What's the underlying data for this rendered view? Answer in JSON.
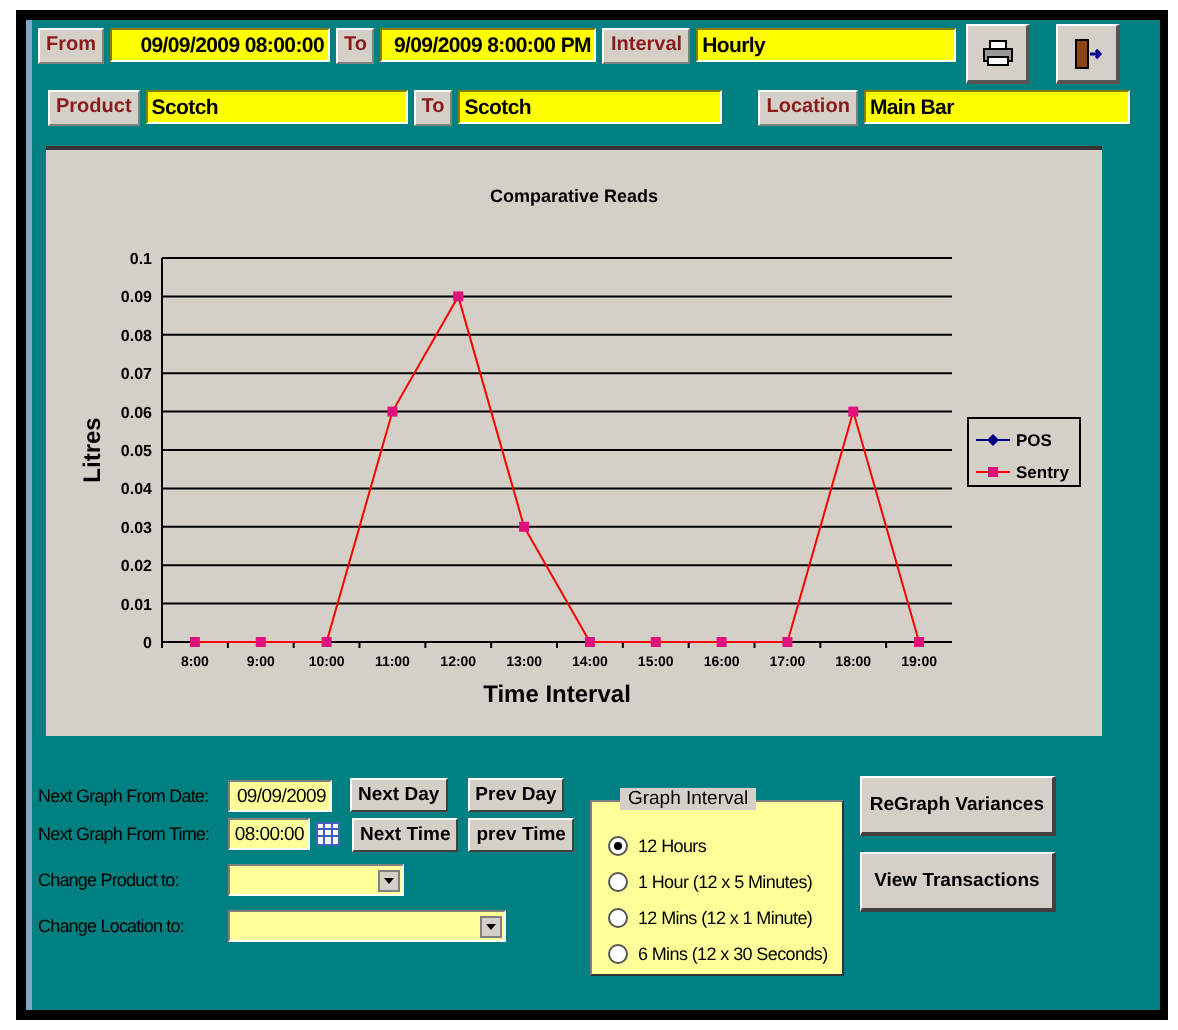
{
  "filter_row_1": {
    "from_label": "From",
    "from_value": "09/09/2009 08:00:00",
    "to_label": "To",
    "to_value": "9/09/2009 8:00:00 PM",
    "interval_label": "Interval",
    "interval_value": "Hourly"
  },
  "filter_row_2": {
    "product_label": "Product",
    "product_value": "Scotch",
    "to_label": "To",
    "to_value": "Scotch",
    "location_label": "Location",
    "location_value": "Main Bar"
  },
  "chart": {
    "chart_data": {
      "type": "line",
      "title": "Comparative Reads",
      "xlabel": "Time Interval",
      "ylabel": "Litres",
      "categories": [
        "8:00",
        "9:00",
        "10:00",
        "11:00",
        "12:00",
        "13:00",
        "14:00",
        "15:00",
        "16:00",
        "17:00",
        "18:00",
        "19:00"
      ],
      "series": [
        {
          "name": "POS",
          "color": "#000080",
          "values": [
            null,
            null,
            null,
            null,
            null,
            null,
            null,
            null,
            null,
            null,
            null,
            null
          ]
        },
        {
          "name": "Sentry",
          "color": "#ff0000",
          "marker": "square",
          "values": [
            0,
            0,
            0,
            0.06,
            0.09,
            0.03,
            0,
            0,
            0,
            0,
            0.06,
            0
          ]
        }
      ],
      "ylim": [
        0,
        0.1
      ],
      "yticks": [
        0,
        0.01,
        0.02,
        0.03,
        0.04,
        0.05,
        0.06,
        0.07,
        0.08,
        0.09,
        0.1
      ],
      "grid": true
    }
  },
  "controls": {
    "next_date_label": "Next Graph From Date:",
    "next_date_value": "09/09/2009",
    "next_day": "Next Day",
    "prev_day": "Prev Day",
    "next_time_label": "Next Graph From Time:",
    "next_time_value": "08:00:00",
    "next_time": "Next Time",
    "prev_time": "prev Time",
    "product_label": "Change Product to:",
    "location_label": "Change Location to:"
  },
  "graph_interval": {
    "title": "Graph Interval",
    "options": [
      {
        "label": "12 Hours",
        "selected": true
      },
      {
        "label": "1 Hour (12 x 5 Minutes)",
        "selected": false
      },
      {
        "label": "12 Mins (12 x 1 Minute)",
        "selected": false
      },
      {
        "label": "6 Mins (12 x 30 Seconds)",
        "selected": false
      }
    ]
  },
  "buttons": [
    "ReGraph Variances",
    "View Transactions"
  ]
}
